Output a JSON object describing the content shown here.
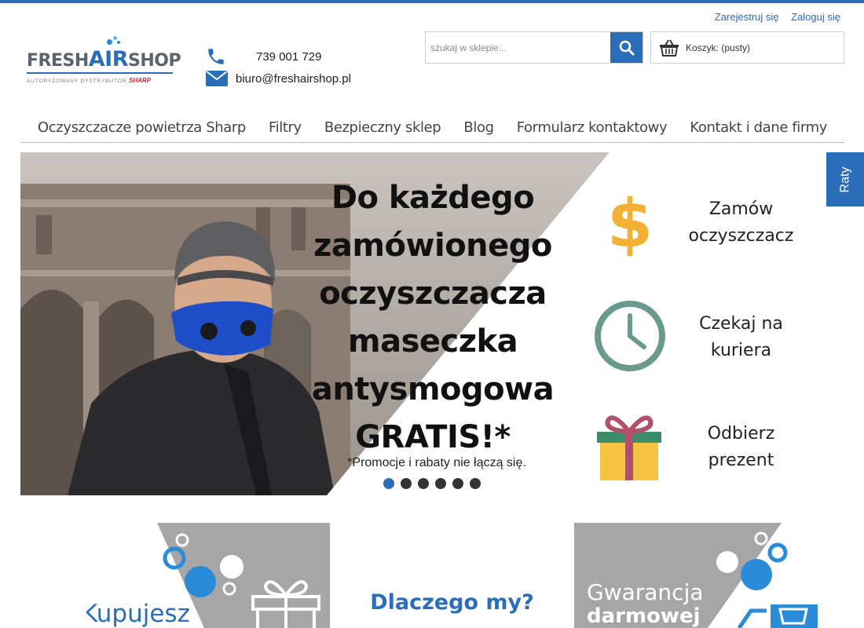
{
  "user_links": {
    "register": "Zarejestruj się",
    "login": "Zaloguj się"
  },
  "logo": {
    "fresh": "FRESH",
    "air": "AIR",
    "shop": "SHOP",
    "subtitle": "AUTORYZOWANY DYSTRYBUTOR",
    "brand": "SHARP"
  },
  "contact": {
    "phone": "739 001 729",
    "email": "biuro@freshairshop.pl"
  },
  "search": {
    "placeholder": "szukaj w sklepie..."
  },
  "cart": {
    "label": "Koszyk: (pusty)"
  },
  "nav": [
    "Oczyszczacze powietrza Sharp",
    "Filtry",
    "Bezpieczny sklep",
    "Blog",
    "Formularz kontaktowy",
    "Kontakt i dane firmy"
  ],
  "raty": "Raty",
  "hero": {
    "lines": [
      "Do każdego",
      "zamówionego",
      "oczyszczacza",
      "maseczka",
      "antysmogowa",
      "GRATIS!*"
    ],
    "note": "*Promocje i rabaty nie łączą się.",
    "steps": [
      {
        "line1": "Zamów",
        "line2": "oczyszczacz"
      },
      {
        "line1": "Czekaj na",
        "line2": "kuriera"
      },
      {
        "line1": "Odbierz",
        "line2": "prezent"
      }
    ],
    "slide_count": 6,
    "active_slide": 1
  },
  "promos": {
    "left": "Kupujesz",
    "center": "Dlaczego my?",
    "right_line1": "Gwarancja",
    "right_line2": "darmowej"
  },
  "colors": {
    "accent": "#2a6db8",
    "dollar": "#f2b135",
    "clock": "#6a9a8c",
    "gift": "#f5c242",
    "ribbon": "#b0506a"
  }
}
